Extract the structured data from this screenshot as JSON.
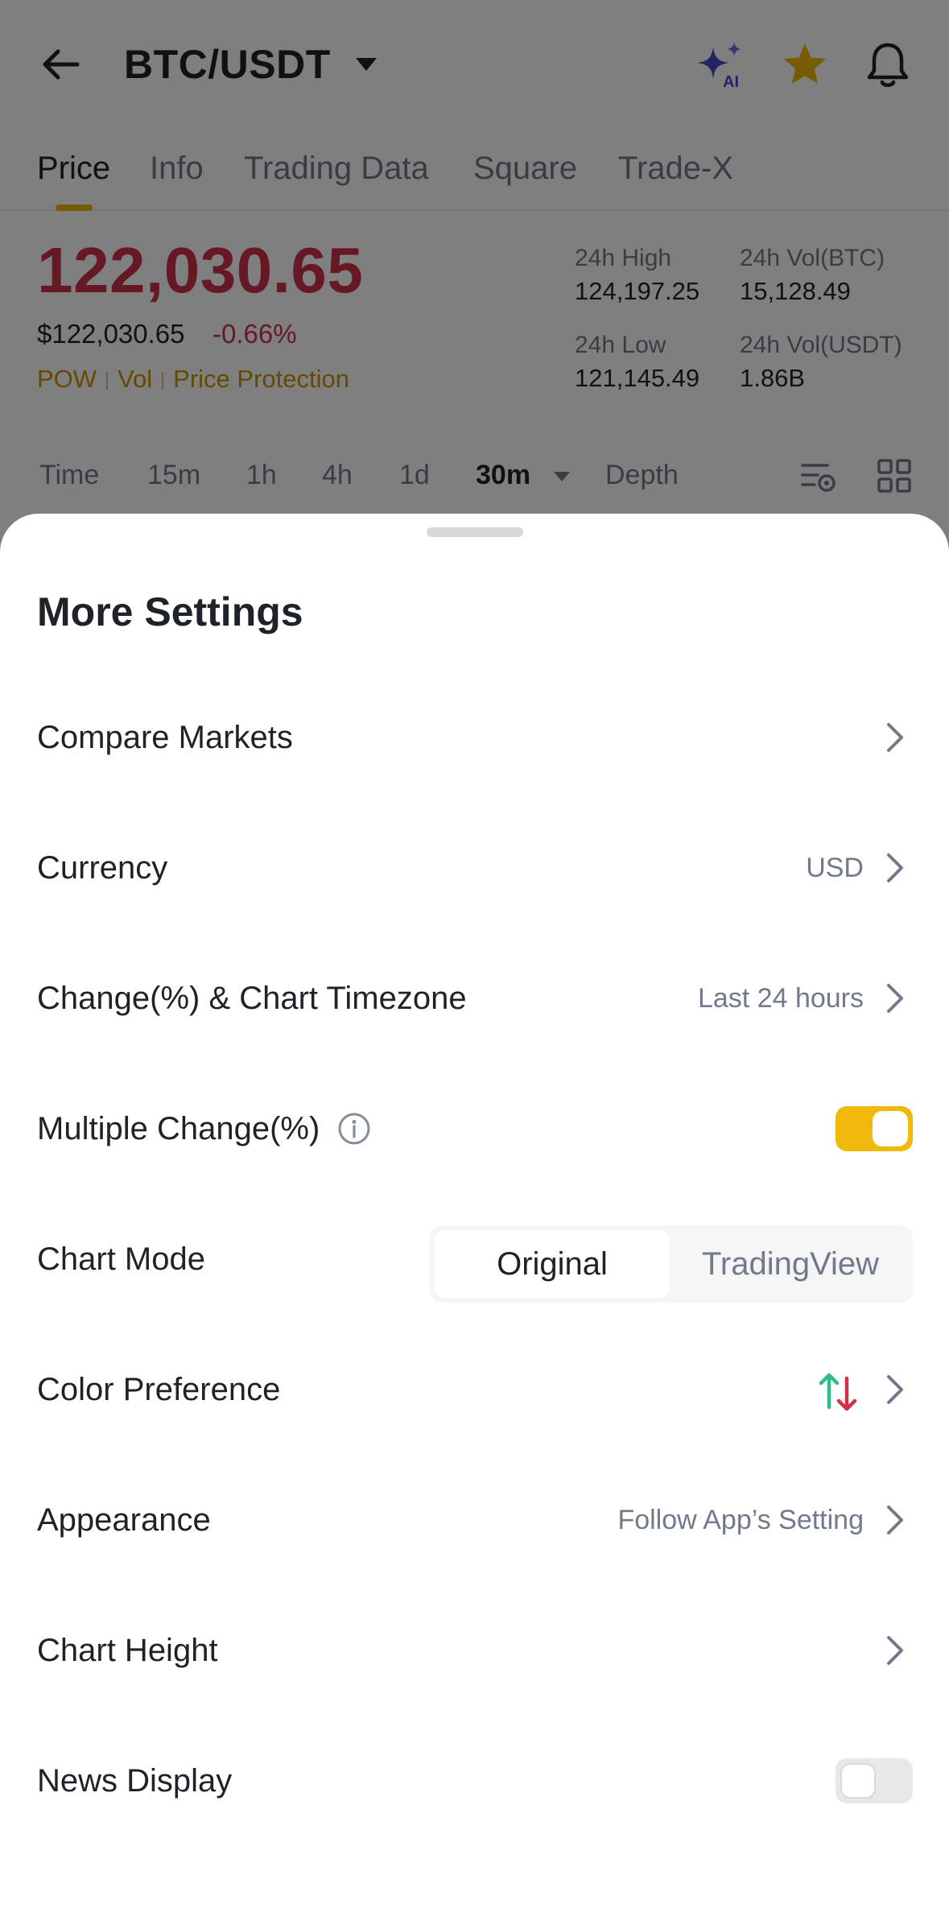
{
  "header": {
    "pair": "BTC/USDT",
    "icons": [
      "back-arrow-icon",
      "caret-down-icon",
      "ai-sparkle-icon",
      "favorite-star-icon",
      "bell-icon"
    ]
  },
  "tabs": [
    {
      "label": "Price",
      "active": true
    },
    {
      "label": "Info"
    },
    {
      "label": "Trading Data"
    },
    {
      "label": "Square"
    },
    {
      "label": "Trade-X"
    }
  ],
  "ticker": {
    "last_price": "122,030.65",
    "usd_price": "$122,030.65",
    "change": "-0.66%",
    "tags": [
      "POW",
      "Vol",
      "Price Protection"
    ],
    "stats": {
      "high_label": "24h High",
      "high_value": "124,197.25",
      "vol_btc_label": "24h Vol(BTC)",
      "vol_btc_value": "15,128.49",
      "low_label": "24h Low",
      "low_value": "121,145.49",
      "vol_usdt_label": "24h Vol(USDT)",
      "vol_usdt_value": "1.86B"
    }
  },
  "intervals": {
    "items": [
      "Time",
      "15m",
      "1h",
      "4h",
      "1d",
      "30m",
      "Depth"
    ],
    "selected": "30m"
  },
  "sheet": {
    "title": "More Settings",
    "rows": {
      "compare_markets": {
        "label": "Compare Markets"
      },
      "currency": {
        "label": "Currency",
        "value": "USD"
      },
      "timezone": {
        "label": "Change(%) & Chart Timezone",
        "value": "Last 24 hours"
      },
      "multiple_change": {
        "label": "Multiple Change(%)",
        "enabled": true
      },
      "chart_mode": {
        "label": "Chart Mode",
        "options": [
          "Original",
          "TradingView"
        ],
        "selected": "Original"
      },
      "color_preference": {
        "label": "Color Preference",
        "icon": "green-up-red-down-icon"
      },
      "appearance": {
        "label": "Appearance",
        "value": "Follow App’s Setting"
      },
      "chart_height": {
        "label": "Chart Height"
      },
      "news_display": {
        "label": "News Display",
        "enabled": false
      }
    }
  },
  "colors": {
    "accent": "#f0b90b",
    "down": "#cf304a",
    "up": "#2ebd85",
    "tag": "#c99400",
    "overlay": "rgba(0,0,0,0.5)"
  }
}
